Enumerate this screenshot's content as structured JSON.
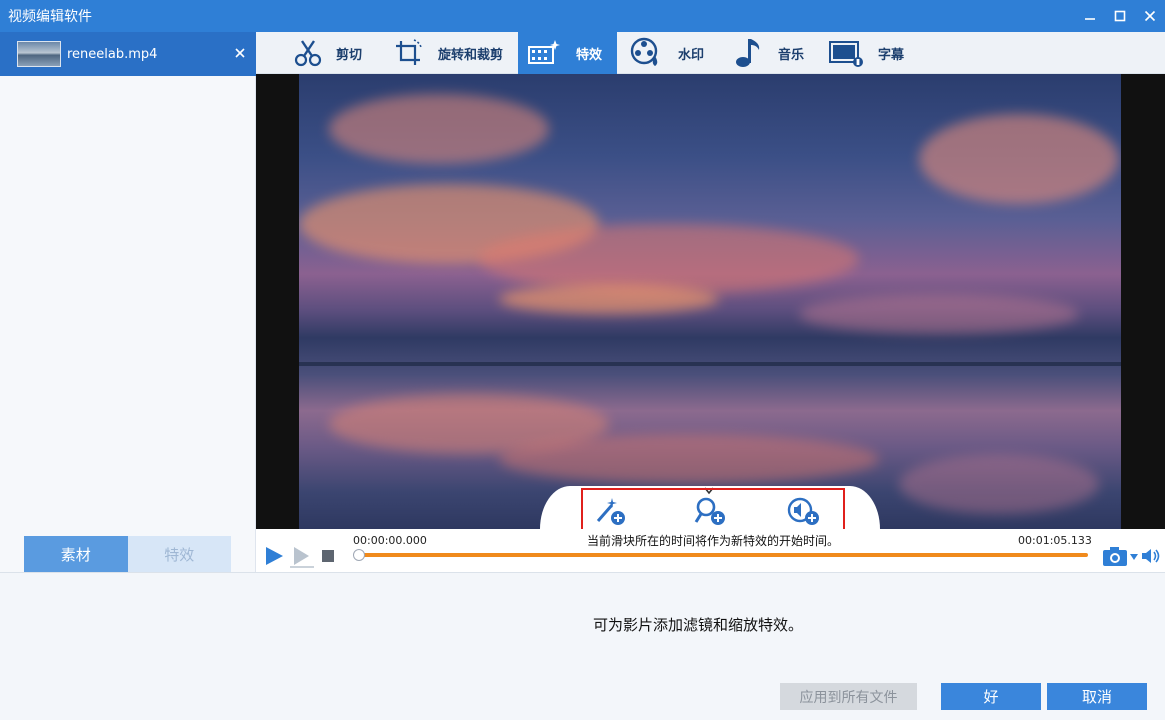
{
  "window": {
    "title": "视频编辑软件",
    "controls": {
      "minimize_icon": "minimize-icon",
      "maximize_icon": "maximize-icon",
      "close_icon": "close-icon"
    }
  },
  "sidebar": {
    "file": {
      "name": "reneelab.mp4",
      "close_icon": "close-icon"
    },
    "tabs": [
      {
        "label": "素材",
        "active": true
      },
      {
        "label": "特效",
        "active": false
      }
    ]
  },
  "toolbar": {
    "tabs": [
      {
        "label": "剪切",
        "icon": "scissors-icon",
        "active": false
      },
      {
        "label": "旋转和裁剪",
        "icon": "rotate-crop-icon",
        "active": false
      },
      {
        "label": "特效",
        "icon": "effects-icon",
        "active": true
      },
      {
        "label": "水印",
        "icon": "watermark-icon",
        "active": false
      },
      {
        "label": "音乐",
        "icon": "music-note-icon",
        "active": false
      },
      {
        "label": "字幕",
        "icon": "subtitle-icon",
        "active": false
      }
    ]
  },
  "effects_panel": {
    "buttons": [
      {
        "icon": "add-filter-icon"
      },
      {
        "icon": "add-zoom-icon"
      },
      {
        "icon": "add-volume-icon"
      }
    ]
  },
  "playback": {
    "current_time": "00:00:00.000",
    "total_time": "00:01:05.133",
    "hint": "当前滑块所在的时间将作为新特效的开始时间。",
    "progress": 0
  },
  "bottom": {
    "description": "可为影片添加滤镜和缩放特效。",
    "apply_all_label": "应用到所有文件",
    "ok_label": "好",
    "cancel_label": "取消"
  },
  "colors": {
    "accent": "#2f7fd6",
    "button_blue": "#3a86dc",
    "track_orange": "#f08a1c",
    "highlight_red": "#e0201c"
  }
}
